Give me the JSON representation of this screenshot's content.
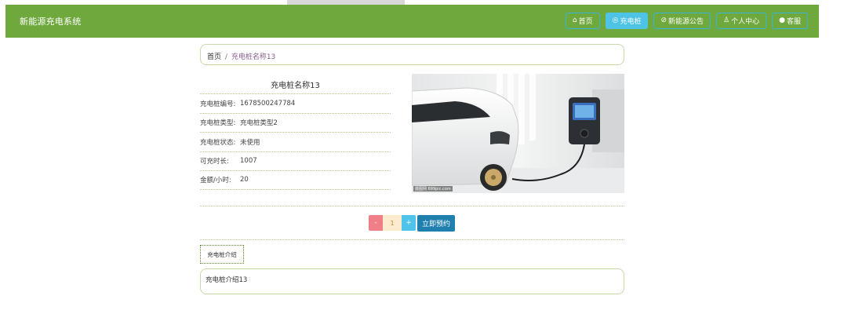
{
  "header": {
    "brand": "新能源充电系统",
    "nav": [
      {
        "label": "首页",
        "icon": "home-icon",
        "active": false
      },
      {
        "label": "充电桩",
        "icon": "charger-icon",
        "active": true
      },
      {
        "label": "新能源公告",
        "icon": "announcement-icon",
        "active": false
      },
      {
        "label": "个人中心",
        "icon": "user-icon",
        "active": false
      },
      {
        "label": "客服",
        "icon": "chat-icon",
        "active": false
      }
    ]
  },
  "breadcrumb": {
    "home": "首页",
    "separator": "/",
    "current": "充电桩名称13"
  },
  "detail": {
    "title": "充电桩名称13",
    "fields": [
      {
        "label": "充电桩编号:",
        "value": "1678500247784"
      },
      {
        "label": "充电桩类型:",
        "value": "充电桩类型2"
      },
      {
        "label": "充电桩状态:",
        "value": "未使用"
      },
      {
        "label": "可充时长:",
        "value": "1007"
      },
      {
        "label": "金额/小时:",
        "value": "20"
      }
    ],
    "image_watermark": "摄图网 699pic.com"
  },
  "booking": {
    "minus": "-",
    "quantity": "1",
    "plus": "+",
    "button": "立即预约"
  },
  "intro": {
    "tab": "充电桩介绍",
    "content": "充电桩介绍13"
  },
  "colors": {
    "navbar": "#6fa83c",
    "nav_active": "#4fc3e6",
    "book_button": "#1f7fae",
    "minus": "#ef7e88",
    "plus": "#4fc3ea"
  }
}
